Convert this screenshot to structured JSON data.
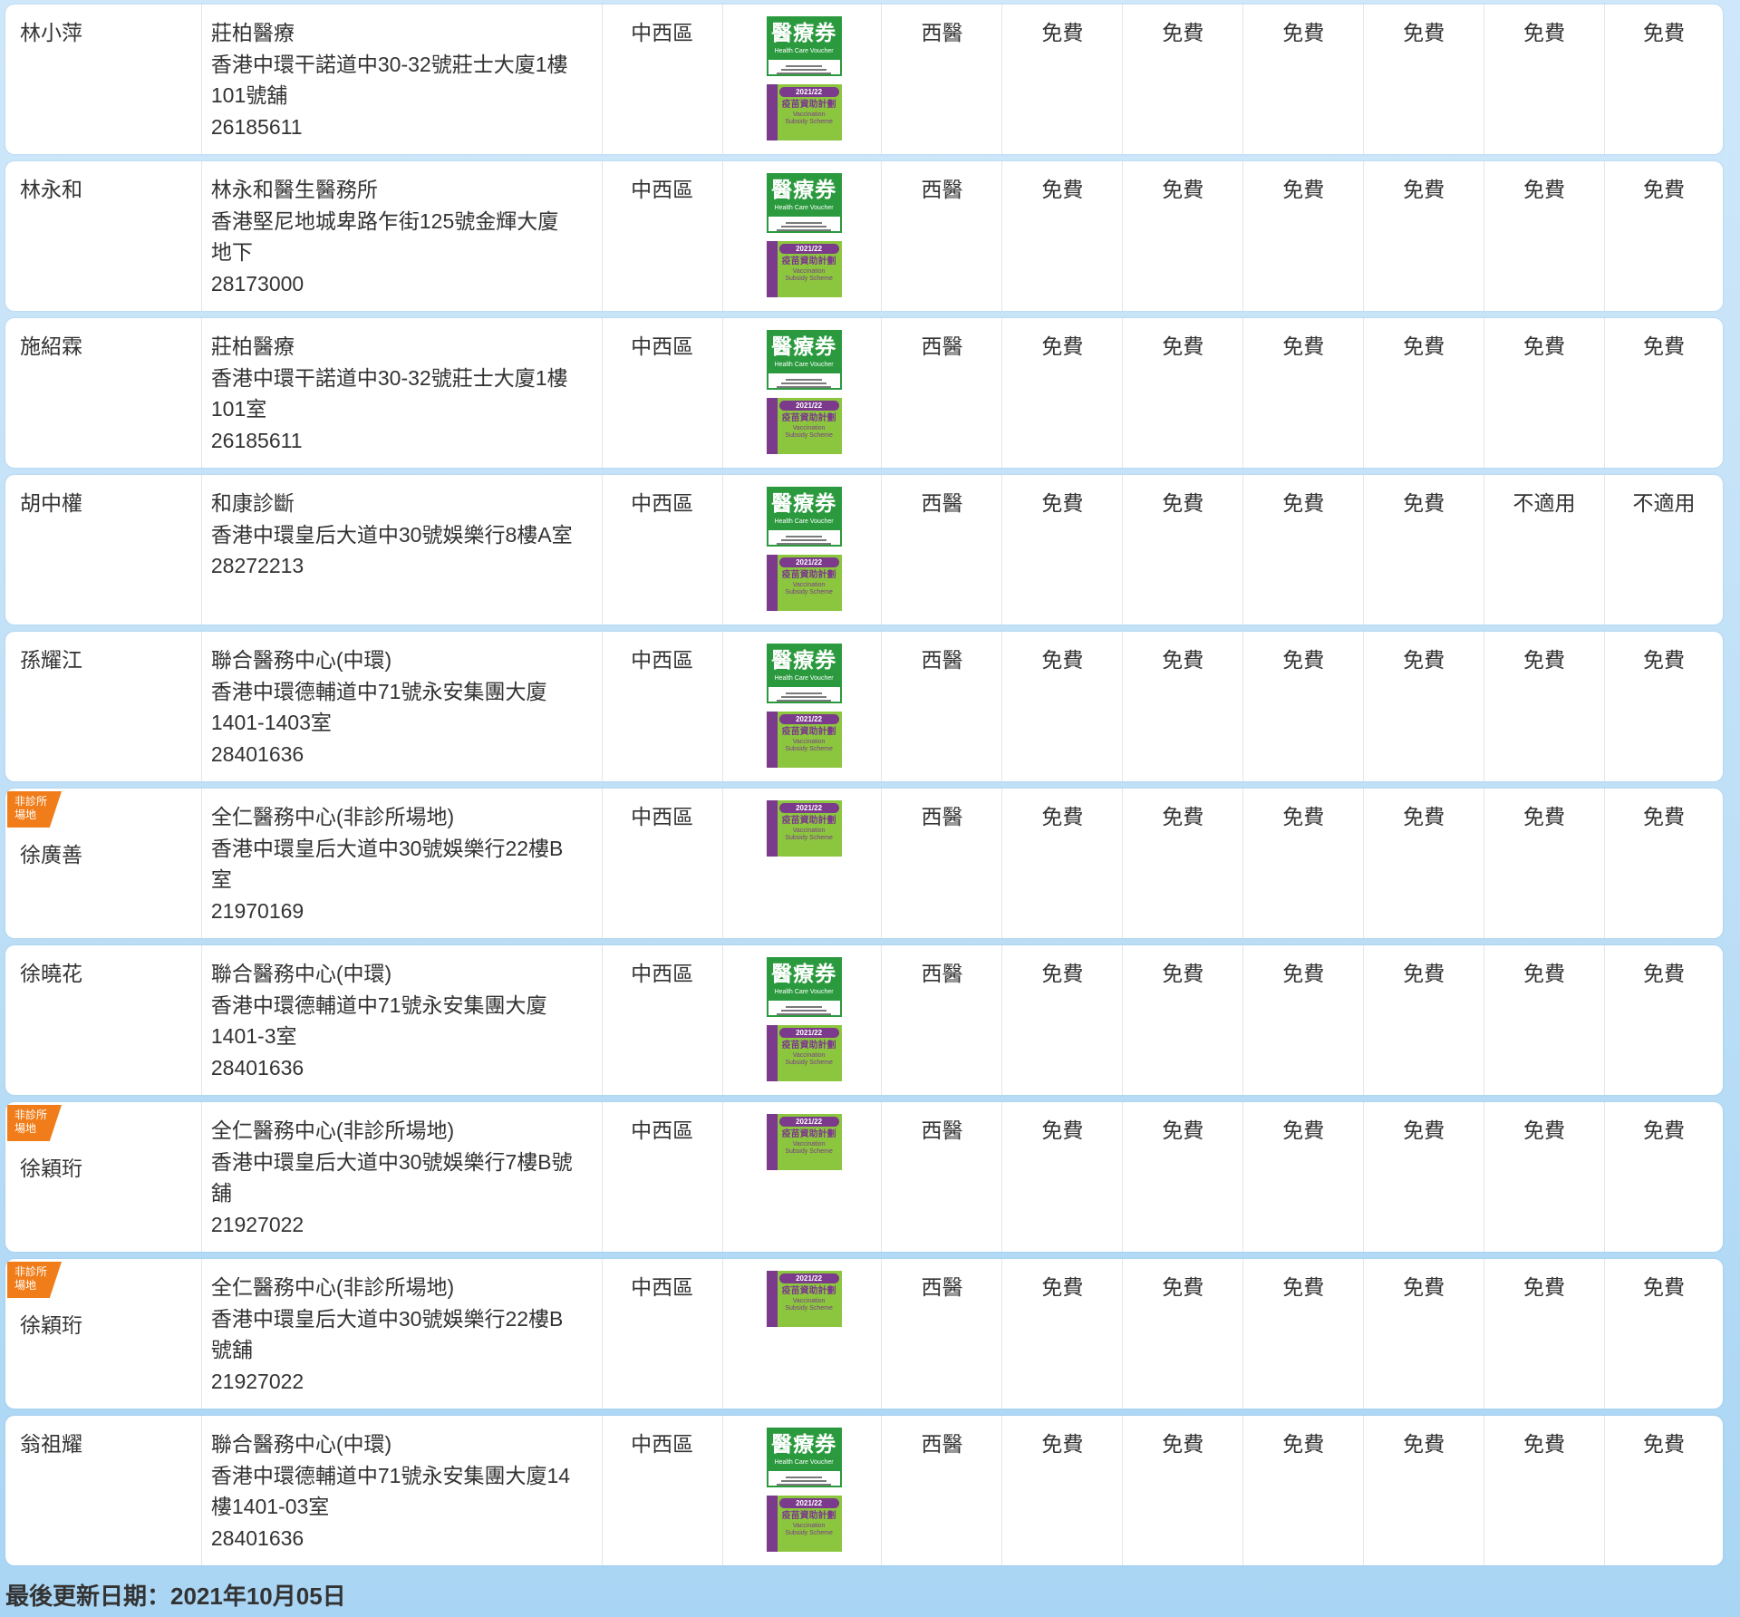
{
  "badges": {
    "hcv_title": "醫療券",
    "hcv_sub": "Health Care Voucher",
    "vss_year": "2021/22",
    "vss_cn": "疫苗資助計劃",
    "vss_en_1": "Vaccination",
    "vss_en_2": "Subsidy Scheme"
  },
  "tag": {
    "line1": "非診所",
    "line2": "場地"
  },
  "rows": [
    {
      "name": "林小萍",
      "tag": false,
      "clinic": "莊柏醫療",
      "address_1": "香港中環干諾道中30-32號莊士大廈1樓",
      "address_2": "101號舖",
      "phone": "26185611",
      "district": "中西區",
      "hcv": true,
      "category": "西醫",
      "fees": [
        "免費",
        "免費",
        "免費",
        "免費",
        "免費",
        "免費"
      ]
    },
    {
      "name": "林永和",
      "tag": false,
      "clinic": "林永和醫生醫務所",
      "address_1": "香港堅尼地城卑路乍街125號金輝大廈",
      "address_2": "地下",
      "phone": "28173000",
      "district": "中西區",
      "hcv": true,
      "category": "西醫",
      "fees": [
        "免費",
        "免費",
        "免費",
        "免費",
        "免費",
        "免費"
      ]
    },
    {
      "name": "施紹霖",
      "tag": false,
      "clinic": "莊柏醫療",
      "address_1": "香港中環干諾道中30-32號莊士大廈1樓",
      "address_2": "101室",
      "phone": "26185611",
      "district": "中西區",
      "hcv": true,
      "category": "西醫",
      "fees": [
        "免費",
        "免費",
        "免費",
        "免費",
        "免費",
        "免費"
      ]
    },
    {
      "name": "胡中權",
      "tag": false,
      "clinic": "和康診斷",
      "address_1": "香港中環皇后大道中30號娛樂行8樓A室",
      "address_2": "",
      "phone": "28272213",
      "district": "中西區",
      "hcv": true,
      "category": "西醫",
      "fees": [
        "免費",
        "免費",
        "免費",
        "免費",
        "不適用",
        "不適用"
      ]
    },
    {
      "name": "孫耀江",
      "tag": false,
      "clinic": "聯合醫務中心(中環)",
      "address_1": "香港中環德輔道中71號永安集團大廈",
      "address_2": "1401-1403室",
      "phone": "28401636",
      "district": "中西區",
      "hcv": true,
      "category": "西醫",
      "fees": [
        "免費",
        "免費",
        "免費",
        "免費",
        "免費",
        "免費"
      ]
    },
    {
      "name": "徐廣善",
      "tag": true,
      "clinic": "全仁醫務中心(非診所場地)",
      "address_1": "香港中環皇后大道中30號娛樂行22樓B",
      "address_2": "室",
      "phone": "21970169",
      "district": "中西區",
      "hcv": false,
      "category": "西醫",
      "fees": [
        "免費",
        "免費",
        "免費",
        "免費",
        "免費",
        "免費"
      ]
    },
    {
      "name": "徐曉花",
      "tag": false,
      "clinic": "聯合醫務中心(中環)",
      "address_1": "香港中環德輔道中71號永安集團大廈",
      "address_2": "1401-3室",
      "phone": "28401636",
      "district": "中西區",
      "hcv": true,
      "category": "西醫",
      "fees": [
        "免費",
        "免費",
        "免費",
        "免費",
        "免費",
        "免費"
      ]
    },
    {
      "name": "徐穎珩",
      "tag": true,
      "clinic": "全仁醫務中心(非診所場地)",
      "address_1": "香港中環皇后大道中30號娛樂行7樓B號",
      "address_2": "舖",
      "phone": "21927022",
      "district": "中西區",
      "hcv": false,
      "category": "西醫",
      "fees": [
        "免費",
        "免費",
        "免費",
        "免費",
        "免費",
        "免費"
      ]
    },
    {
      "name": "徐穎珩",
      "tag": true,
      "clinic": "全仁醫務中心(非診所場地)",
      "address_1": "香港中環皇后大道中30號娛樂行22樓B",
      "address_2": "號舖",
      "phone": "21927022",
      "district": "中西區",
      "hcv": false,
      "category": "西醫",
      "fees": [
        "免費",
        "免費",
        "免費",
        "免費",
        "免費",
        "免費"
      ]
    },
    {
      "name": "翁祖耀",
      "tag": false,
      "clinic": "聯合醫務中心(中環)",
      "address_1": "香港中環德輔道中71號永安集團大廈14",
      "address_2": "樓1401-03室",
      "phone": "28401636",
      "district": "中西區",
      "hcv": true,
      "category": "西醫",
      "fees": [
        "免費",
        "免費",
        "免費",
        "免費",
        "免費",
        "免費"
      ]
    }
  ],
  "footer": {
    "last_updated": "最後更新日期：2021年10月05日"
  },
  "colors": {
    "background": "#bfe0f7",
    "tag_orange": "#f07d1a",
    "hcv_green": "#2b9a3e",
    "vss_green": "#8cc63e",
    "vss_purple": "#7b3a8c"
  }
}
